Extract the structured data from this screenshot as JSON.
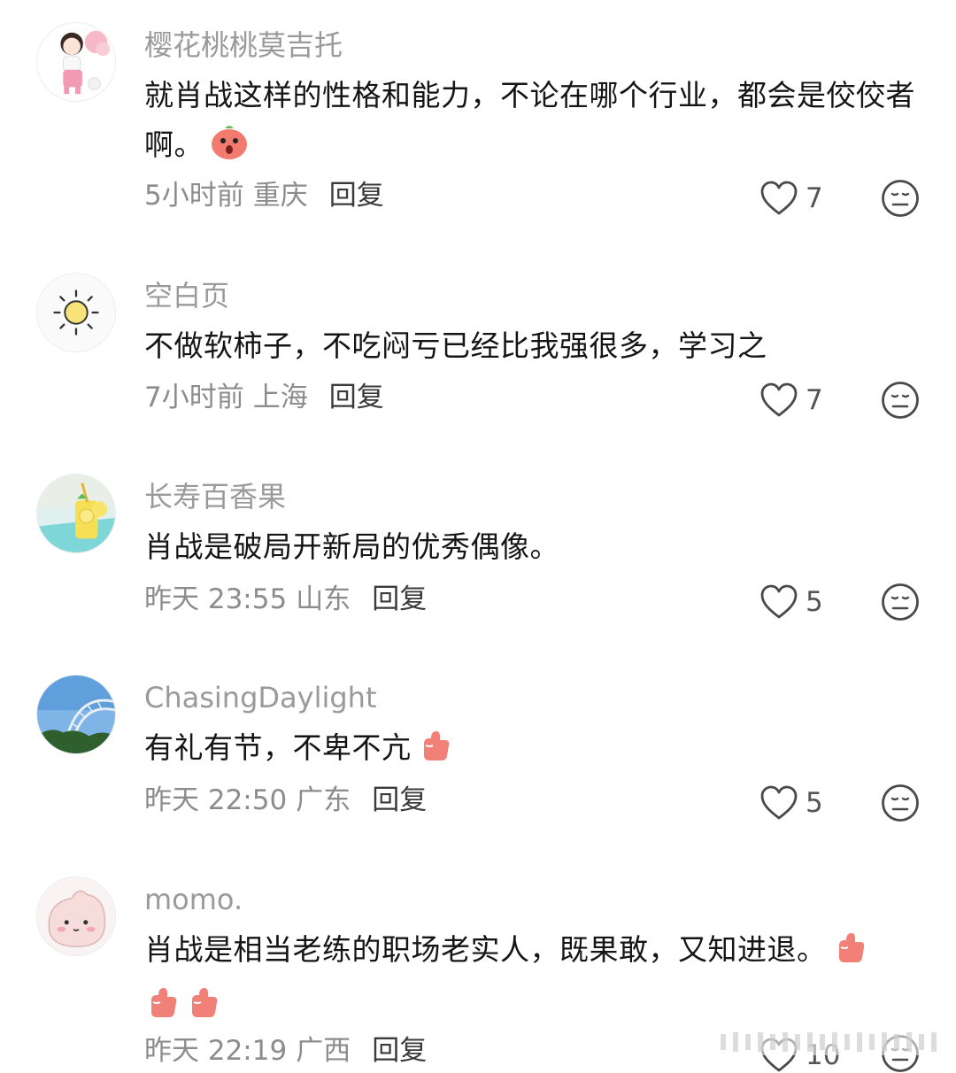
{
  "comments": [
    {
      "username": "樱花桃桃莫吉托",
      "text": "就肖战这样的性格和能力，不论在哪个行业，都会是佼佼者啊。",
      "time": "5小时前",
      "location": "重庆",
      "reply_label": "回复",
      "likes": "7",
      "avatar_icon": "girl-with-flowers-avatar",
      "inline_emoji": [
        "surprised-peach-emoji"
      ]
    },
    {
      "username": "空白页",
      "text": "不做软柿子，不吃闷亏已经比我强很多，学习之",
      "time": "7小时前",
      "location": "上海",
      "reply_label": "回复",
      "likes": "7",
      "avatar_icon": "sun-avatar"
    },
    {
      "username": "长寿百香果",
      "text": "肖战是破局开新局的优秀偶像。",
      "time": "昨天 23:55",
      "location": "山东",
      "reply_label": "回复",
      "likes": "5",
      "avatar_icon": "lemon-drink-avatar"
    },
    {
      "username": "ChasingDaylight",
      "text": "有礼有节，不卑不亢",
      "time": "昨天 22:50",
      "location": "广东",
      "reply_label": "回复",
      "likes": "5",
      "avatar_icon": "sky-arch-avatar",
      "inline_emoji": [
        "thumbs-up-emoji"
      ]
    },
    {
      "username": "momo.",
      "text": "肖战是相当老练的职场老实人，既果敢，又知进退。",
      "time": "昨天 22:19",
      "location": "广西",
      "reply_label": "回复",
      "likes": "10",
      "avatar_icon": "pink-blob-avatar",
      "inline_emoji": [
        "thumbs-up-emoji",
        "thumbs-up-emoji",
        "thumbs-up-emoji"
      ]
    }
  ],
  "colors": {
    "username": "#9a9a9a",
    "meta": "#8c8c8c",
    "text": "#151515",
    "icon_stroke": "#4a4a4a"
  }
}
